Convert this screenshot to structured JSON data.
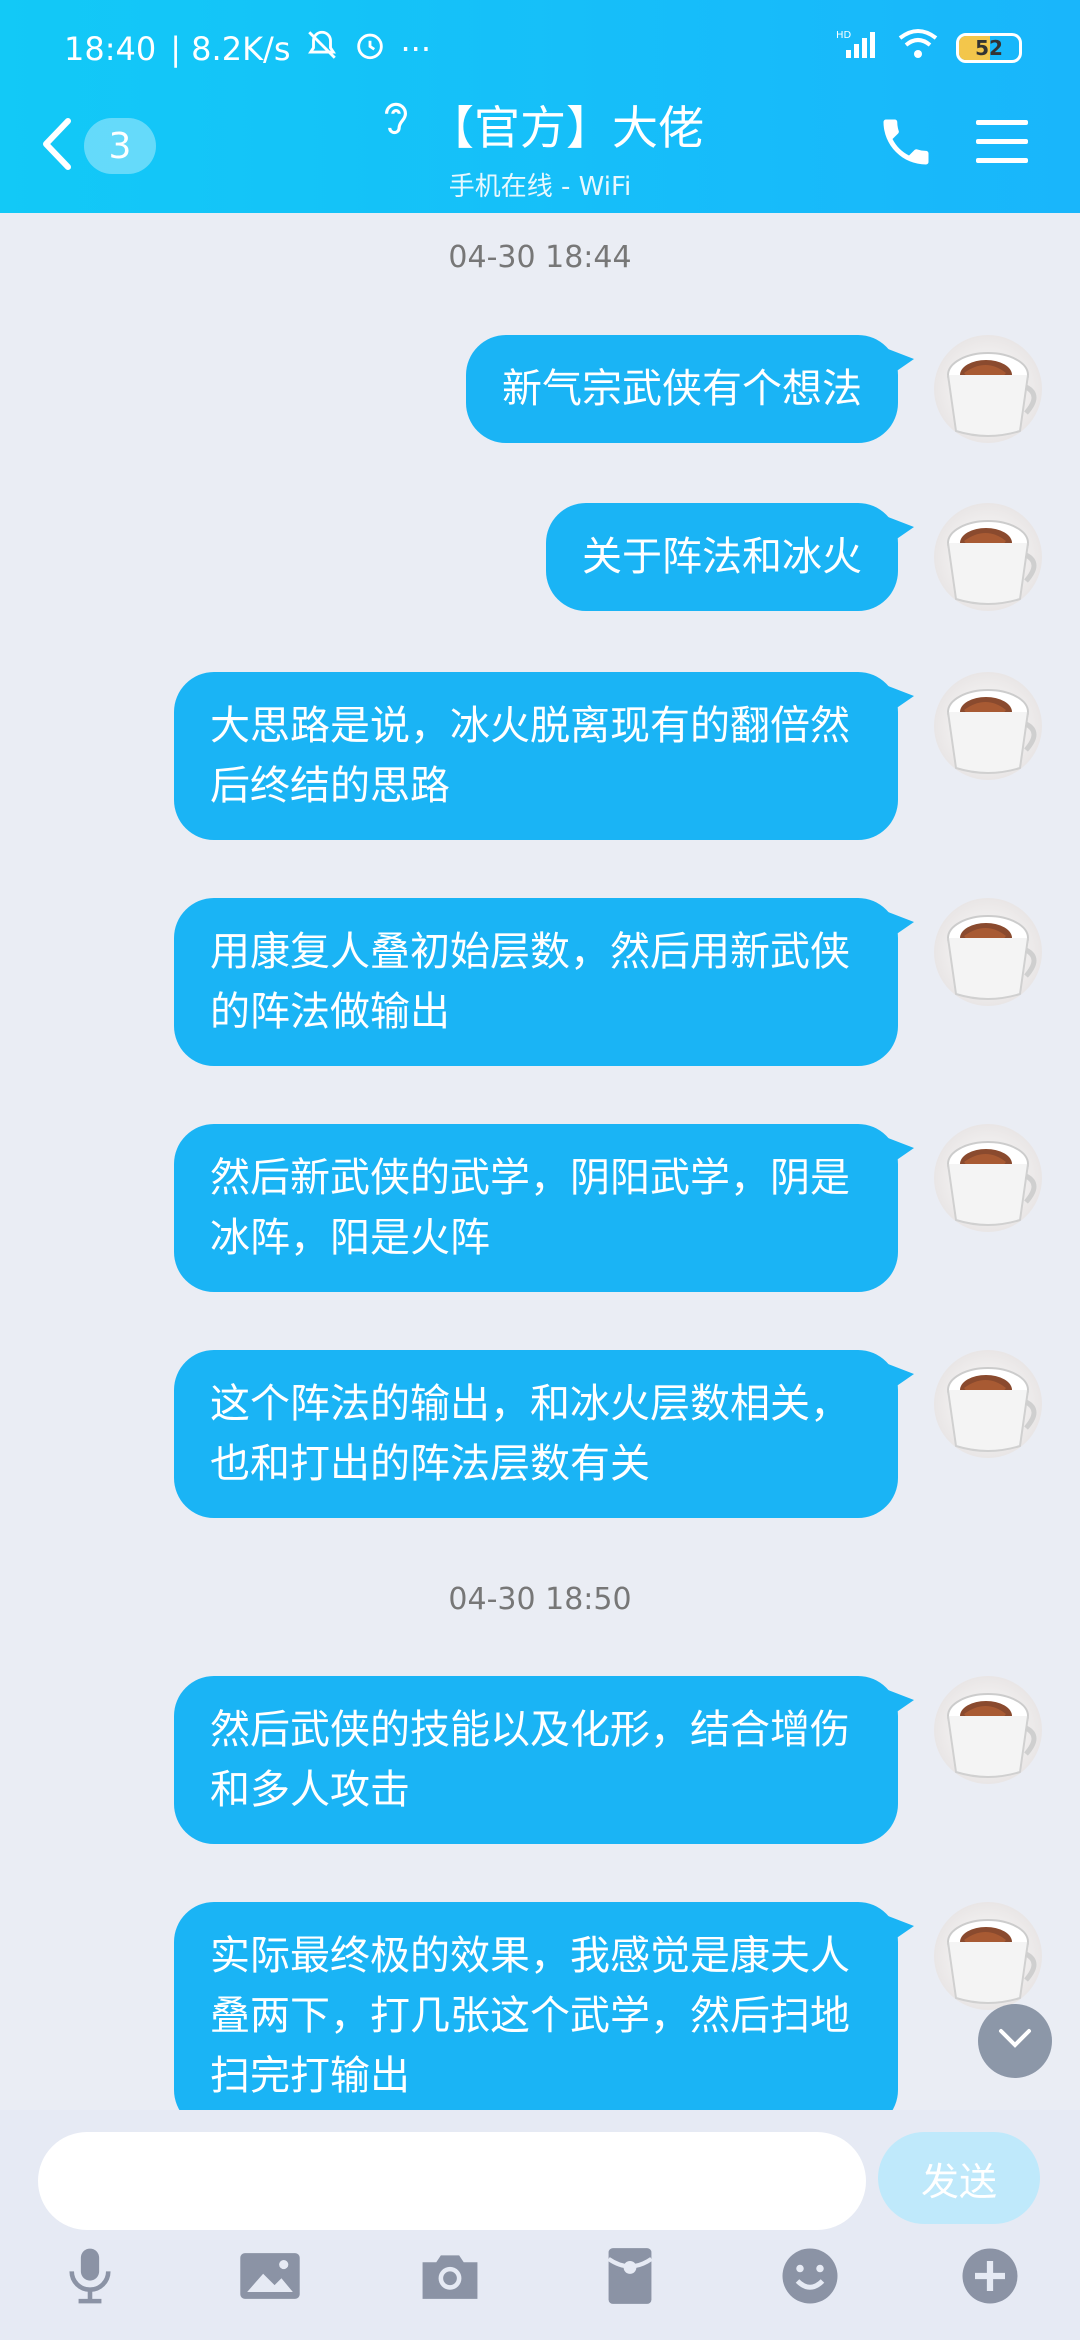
{
  "status_bar": {
    "time": "18:40",
    "speed": "| 8.2K/s",
    "more": "···",
    "signal_label": "HD",
    "battery": "52",
    "battery_level": 0.52
  },
  "header": {
    "unread_count": "3",
    "title": "【官方】大佬",
    "subtitle": "手机在线 - WiFi"
  },
  "timestamps": [
    "04-30 18:44",
    "04-30 18:50"
  ],
  "messages": [
    {
      "text": "新气宗武侠有个想法"
    },
    {
      "text": "关于阵法和冰火"
    },
    {
      "text": "大思路是说，冰火脱离现有的翻倍然后终结的思路"
    },
    {
      "text": "用康复人叠初始层数，然后用新武侠的阵法做输出"
    },
    {
      "text": "然后新武侠的武学，阴阳武学，阴是冰阵，阳是火阵"
    },
    {
      "text": "这个阵法的输出，和冰火层数相关，也和打出的阵法层数有关"
    },
    {
      "text": "然后武侠的技能以及化形，结合增伤和多人攻击"
    },
    {
      "text": "实际最终极的效果，我感觉是康夫人叠两下，打几张这个武学，然后扫地扫完打输出"
    }
  ],
  "input": {
    "placeholder": "",
    "send_label": "发送"
  },
  "icons": {
    "back": "chevron-left-icon",
    "ear": "ear-icon",
    "call": "phone-icon",
    "menu": "menu-icon",
    "mic": "microphone-icon",
    "image": "image-icon",
    "camera": "camera-icon",
    "redpacket": "red-packet-icon",
    "emoji": "emoji-icon",
    "plus": "plus-icon"
  },
  "colors": {
    "header": "#19b6fb",
    "bubble": "#1ab4f5",
    "background": "#eaedf4",
    "send_button": "#bfe9fb"
  }
}
